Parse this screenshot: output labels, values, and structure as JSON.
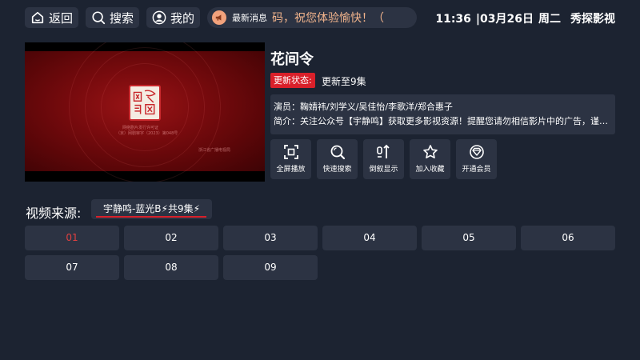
{
  "topbar": {
    "back_label": "返回",
    "search_label": "搜索",
    "mine_label": "我的",
    "notice_label": "最新消息",
    "notice_text": "换码，祝您体验愉快！（",
    "time": "11:36",
    "date": "|03月26日",
    "weekday": "周二",
    "app_name": "秀探影视"
  },
  "video": {
    "caption_main": "网络剧片发行许可证",
    "caption_sub": "（京）网剧审字（2023）第048号",
    "caption_corner": "浙江省广播电视局"
  },
  "detail": {
    "title": "花间令",
    "status_label": "更新状态:",
    "status_value": "更新至9集",
    "actors": "演员：鞠婧祎/刘学义/吴佳怡/李歌洋/郑合惠子",
    "intro": "简介：关注公众号【宇静鸣】获取更多影视资源！提醒您请勿相信影片中的广告，谨防上当受骗！"
  },
  "actions": [
    {
      "label": "全屏播放",
      "icon": "fullscreen-icon"
    },
    {
      "label": "快速搜索",
      "icon": "search-icon"
    },
    {
      "label": "倒叙显示",
      "icon": "sort-icon"
    },
    {
      "label": "加入收藏",
      "icon": "star-icon"
    },
    {
      "label": "开通会员",
      "icon": "vip-icon"
    }
  ],
  "sources": {
    "label": "视频来源:",
    "selected": "宇静鸣-蓝光B⚡共9集⚡"
  },
  "episodes": [
    "01",
    "02",
    "03",
    "04",
    "05",
    "06",
    "07",
    "08",
    "09"
  ],
  "colors": {
    "background": "#1c2331",
    "panel": "#2c3343",
    "accent": "#d9202a",
    "notice": "#f2b48c"
  }
}
